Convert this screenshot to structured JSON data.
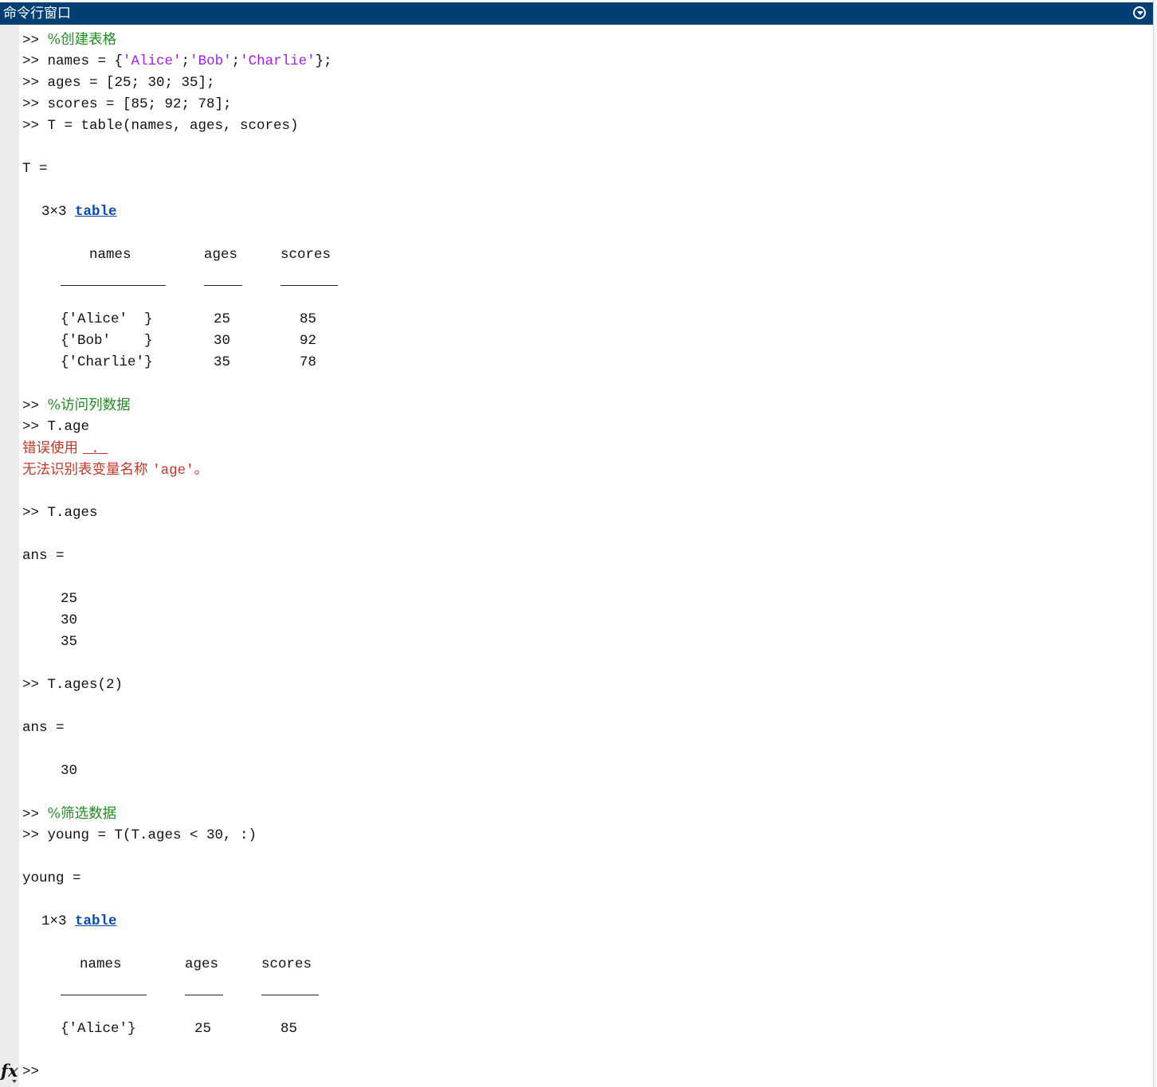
{
  "window": {
    "title": "命令行窗口"
  },
  "lines": {
    "l1_prompt": ">> ",
    "l1_comment": "%创建表格",
    "l2_prompt": ">> ",
    "l2_a": "names = {",
    "l2_s1": "'Alice'",
    "l2_sep1": ";",
    "l2_s2": "'Bob'",
    "l2_sep2": ";",
    "l2_s3": "'Charlie'",
    "l2_end": "};",
    "l3": ">> ages = [25; 30; 35];",
    "l4": ">> scores = [85; 92; 78];",
    "l5": ">> T = table(names, ages, scores)",
    "t_assign": "T =",
    "t_size": "3×3 ",
    "t_link": "table",
    "t_headers": [
      "names",
      "ages",
      "scores"
    ],
    "t_rows": [
      [
        "{'Alice'  }",
        "25",
        "85"
      ],
      [
        "{'Bob'    }",
        "30",
        "92"
      ],
      [
        "{'Charlie'}",
        "35",
        "78"
      ]
    ],
    "c2_prompt": ">> ",
    "c2_comment": "%访问列数据",
    "tage": ">> T.age",
    "err1_text": "错误使用 ",
    "err1_link": " . ",
    "err2_text": "无法识别表变量名称 ",
    "err2_code": "'age'",
    "err2_end": "。",
    "tages": ">> T.ages",
    "ans1": "ans =",
    "ans1_vals": [
      "25",
      "30",
      "35"
    ],
    "tages2": ">> T.ages(2)",
    "ans2": "ans =",
    "ans2_val": "30",
    "c3_prompt": ">> ",
    "c3_comment": "%筛选数据",
    "young_cmd": ">> young = T(T.ages < 30, :)",
    "young_assign": "young =",
    "y_size": "1×3 ",
    "y_link": "table",
    "y_headers": [
      "names",
      "ages",
      "scores"
    ],
    "y_row": [
      "{'Alice'}",
      "25",
      "85"
    ],
    "final_prompt": ">>"
  },
  "icons": {
    "fx": "fx",
    "title_menu": "circle-chevron-down-icon"
  },
  "colors": {
    "title_bg": "#003f73",
    "comment": "#228b22",
    "string": "#a020f0",
    "error": "#c0392b",
    "link": "#0e4da6"
  }
}
